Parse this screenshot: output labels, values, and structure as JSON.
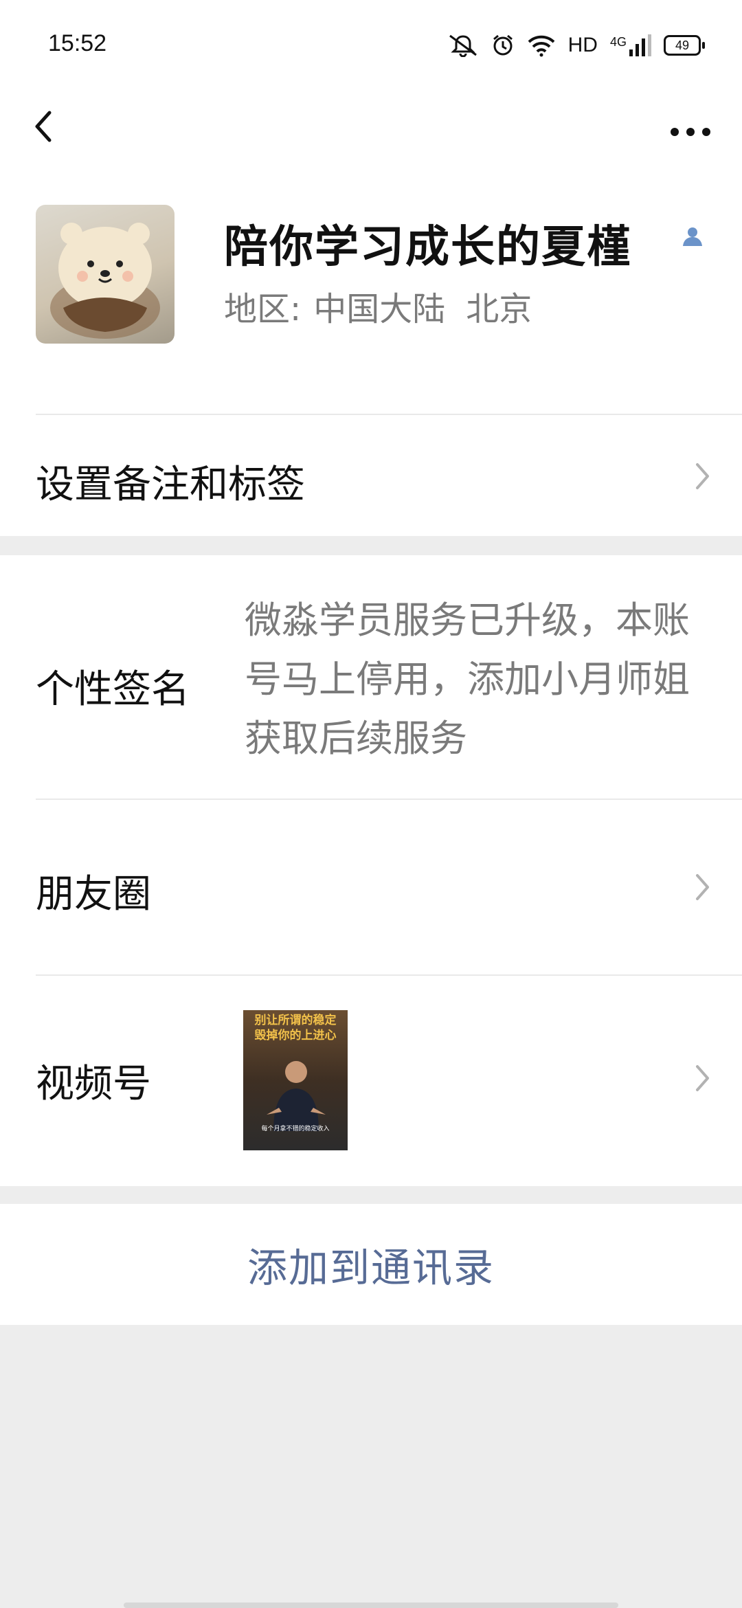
{
  "status_bar": {
    "time": "15:52",
    "network_label": "HD",
    "network_type": "4G",
    "battery": "49",
    "icons": [
      "mute-bell-icon",
      "alarm-icon",
      "wifi-icon",
      "signal-icon",
      "battery-icon"
    ]
  },
  "nav": {
    "back_icon": "back-chevron-icon",
    "more_icon": "more-dots-icon"
  },
  "profile": {
    "name": "陪你学习成长的夏槿",
    "region_label": "地区:",
    "region_country": "中国大陆",
    "region_city": "北京",
    "badge_icon": "contact-person-icon"
  },
  "rows": {
    "remark_label": "设置备注和标签",
    "signature_label": "个性签名",
    "signature_text": "微淼学员服务已升级，本账号马上停用，添加小月师姐获取后续服务",
    "moments_label": "朋友圈",
    "channels_label": "视频号"
  },
  "video_thumb": {
    "title_line1": "别让所谓的稳定",
    "title_line2": "毁掉你的上进心",
    "caption": "每个月拿不错的稳定收入"
  },
  "actions": {
    "add_to_contacts": "添加到通讯录"
  },
  "colors": {
    "link_blue": "#576b95",
    "page_bg": "#ededed",
    "gray_text": "#7a7a7a"
  }
}
